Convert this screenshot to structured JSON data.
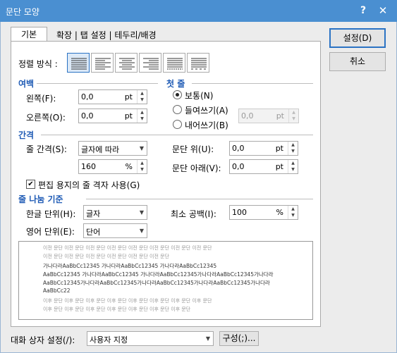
{
  "window": {
    "title": "문단 모양",
    "help_label": "?",
    "close_label": "✕"
  },
  "tabs": {
    "active": "기본",
    "rest": "확장 | 탭 설정 | 테두리/배경"
  },
  "buttons": {
    "ok": "설정(D)",
    "cancel": "취소",
    "config": "구성(;)..."
  },
  "alignment": {
    "label": "정렬 방식 :",
    "options": [
      "양쪽 정렬",
      "왼쪽 정렬",
      "가운데 정렬",
      "오른쪽 정렬",
      "배분 정렬",
      "나눔 정렬"
    ],
    "selected": 0
  },
  "margin": {
    "section": "여백",
    "left_label": "왼쪽(F):",
    "left_value": "0,0",
    "left_unit": "pt",
    "right_label": "오른쪽(O):",
    "right_value": "0,0",
    "right_unit": "pt"
  },
  "first_line": {
    "section": "첫 줄",
    "normal": "보통(N)",
    "indent": "들여쓰기(A)",
    "outdent": "내어쓰기(B)",
    "selected": "보통(N)",
    "value": "0,0",
    "unit": "pt"
  },
  "spacing": {
    "section": "간격",
    "line_label": "줄 간격(S):",
    "line_type": "글자에 따라",
    "line_value": "160",
    "line_unit": "%",
    "above_label": "문단 위(U):",
    "above_value": "0,0",
    "above_unit": "pt",
    "below_label": "문단 아래(V):",
    "below_value": "0,0",
    "below_unit": "pt",
    "grid_label": "편집 용지의 줄 격자 사용(G)",
    "grid_checked": true
  },
  "line_break": {
    "section": "줄 나눔 기준",
    "korean_label": "한글 단위(H):",
    "korean_value": "글자",
    "english_label": "영어 단위(E):",
    "english_value": "단어",
    "min_space_label": "최소 공백(I):",
    "min_space_value": "100",
    "min_space_unit": "%"
  },
  "preview": {
    "lines": [
      "이전 문단 이전 문단 이전 문단 이전 문단 이전 문단 이전 문단 이전 문단 이전 문단",
      "이전 문단 이전 문단 이전 문단 이전 문단 이전 문단 이전 문단",
      "가나다라AaBbCc12345    가나다라AaBbCc12345    가나다라AaBbCc12345",
      "AaBbCc12345 가나다라AaBbCc12345 가나다라AaBbCc12345가나다라AaBbCc12345가나다라",
      "AaBbCc12345가나다라AaBbCc12345가나다라AaBbCc12345가나다라AaBbCc12345가나다라",
      "AaBbCc22",
      "이후 문단 이후 문단 이후 문단 이후 문단 이후 문단 이후 문단 이후 문단 이후 문단",
      "이후 문단 이후 문단 이후 문단 이후 문단 이후 문단 이후 문단 이후 문단"
    ]
  },
  "footer": {
    "label": "대화 상자 설정(/):",
    "value": "사용자 지정"
  }
}
